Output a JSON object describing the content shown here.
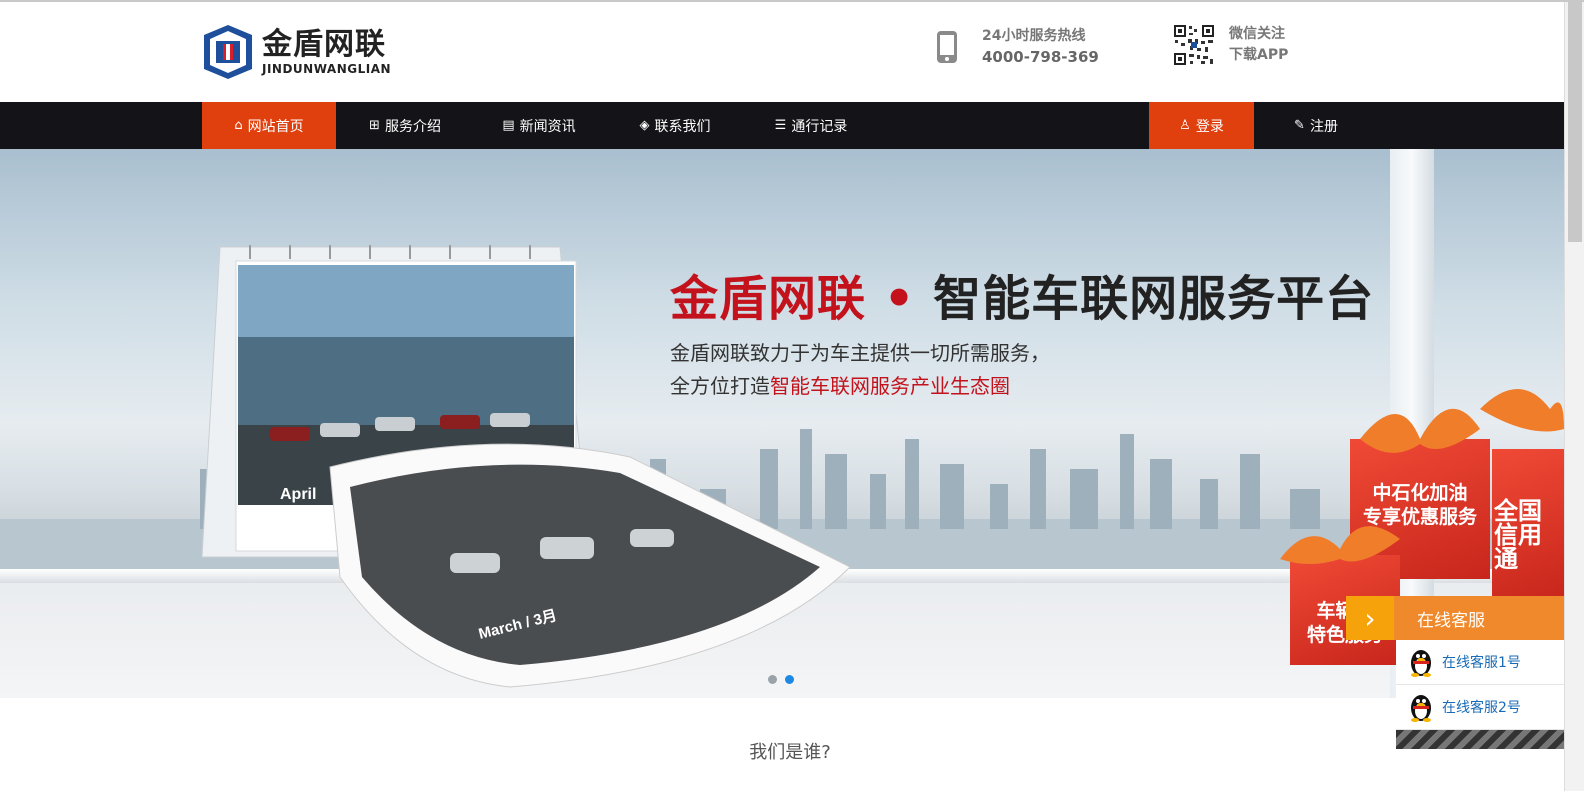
{
  "brand": {
    "name_cn": "金盾网联",
    "name_en": "JINDUNWANGLIAN"
  },
  "hotline": {
    "label": "24小时服务热线",
    "number": "4000-798-369",
    "icon": "phone-icon"
  },
  "wechat": {
    "label": "微信关注",
    "app_label": "下载APP",
    "icon": "qr-code-icon"
  },
  "nav": {
    "items": [
      {
        "label": "网站首页",
        "icon": "home-icon",
        "active": true
      },
      {
        "label": "服务介绍",
        "icon": "grid-icon",
        "active": false
      },
      {
        "label": "新闻资讯",
        "icon": "news-icon",
        "active": false
      },
      {
        "label": "联系我们",
        "icon": "tag-icon",
        "active": false
      },
      {
        "label": "通行记录",
        "icon": "list-icon",
        "active": false
      }
    ],
    "login": {
      "label": "登录",
      "icon": "user-icon"
    },
    "register": {
      "label": "注册",
      "icon": "edit-icon"
    }
  },
  "banner": {
    "title_brand": "金盾网联",
    "title_sep": "•",
    "title_rest": "智能车联网服务平台",
    "desc_line1": "金盾网联致力于为车主提供一切所需服务，",
    "desc_line2_prefix": "全方位打造",
    "desc_line2_highlight": "智能车联网服务产业生态圈",
    "calendar_month_top": "April",
    "calendar_month_bottom": "March / 3月",
    "gifts": [
      "中石化加油\n专享优惠服务",
      "全国\n信用通",
      "车辆保\n特色服务"
    ],
    "slides": 2,
    "active_slide": 2
  },
  "customer_service": {
    "title": "在线客服",
    "agents": [
      "在线客服1号",
      "在线客服2号"
    ]
  },
  "section": {
    "who_title": "我们是谁?"
  },
  "colors": {
    "accent": "#e0400e",
    "nav_bg": "#131318",
    "title_red": "#c3121b",
    "service_orange": "#f0892b"
  }
}
